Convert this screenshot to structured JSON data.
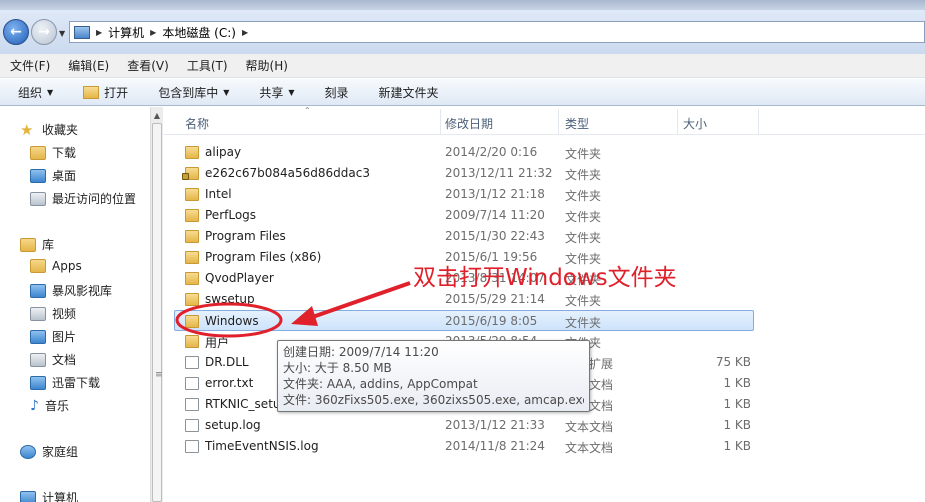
{
  "address": {
    "crumbs": [
      "计算机",
      "本地磁盘 (C:)"
    ]
  },
  "menu": [
    "文件(F)",
    "编辑(E)",
    "查看(V)",
    "工具(T)",
    "帮助(H)"
  ],
  "toolbar": {
    "organize": "组织",
    "open": "打开",
    "include": "包含到库中",
    "share": "共享",
    "burn": "刻录",
    "new_folder": "新建文件夹"
  },
  "nav": {
    "favorites": "收藏夹",
    "downloads": "下载",
    "desktop": "桌面",
    "recent": "最近访问的位置",
    "libraries": "库",
    "apps": "Apps",
    "storm": "暴风影视库",
    "videos": "视频",
    "pictures": "图片",
    "documents": "文档",
    "thunder": "迅雷下载",
    "music": "音乐",
    "homegroup": "家庭组",
    "computer": "计算机"
  },
  "columns": {
    "name": "名称",
    "modified": "修改日期",
    "type": "类型",
    "size": "大小"
  },
  "files": [
    {
      "name": "alipay",
      "date": "2014/2/20 0:16",
      "type": "文件夹",
      "size": ""
    },
    {
      "name": "e262c67b084a56d86ddac3",
      "date": "2013/12/11 21:32",
      "type": "文件夹",
      "size": ""
    },
    {
      "name": "Intel",
      "date": "2013/1/12 21:18",
      "type": "文件夹",
      "size": ""
    },
    {
      "name": "PerfLogs",
      "date": "2009/7/14 11:20",
      "type": "文件夹",
      "size": ""
    },
    {
      "name": "Program Files",
      "date": "2015/1/30 22:43",
      "type": "文件夹",
      "size": ""
    },
    {
      "name": "Program Files (x86)",
      "date": "2015/6/1 19:56",
      "type": "文件夹",
      "size": ""
    },
    {
      "name": "QvodPlayer",
      "date": "2013/8/31 14:07",
      "type": "文件夹",
      "size": ""
    },
    {
      "name": "swsetup",
      "date": "2015/5/29 21:14",
      "type": "文件夹",
      "size": ""
    },
    {
      "name": "Windows",
      "date": "2015/6/19 8:05",
      "type": "文件夹",
      "size": ""
    },
    {
      "name": "用户",
      "date": "2013/5/29 8:54",
      "type": "文件夹",
      "size": ""
    },
    {
      "name": "DR.DLL",
      "date": "",
      "type": "程序扩展",
      "size": "75 KB"
    },
    {
      "name": "error.txt",
      "date": "",
      "type": "文本文档",
      "size": "1 KB"
    },
    {
      "name": "RTKNIC_setup",
      "date": "",
      "type": "文本文档",
      "size": "1 KB"
    },
    {
      "name": "setup.log",
      "date": "2013/1/12 21:33",
      "type": "文本文档",
      "size": "1 KB"
    },
    {
      "name": "TimeEventNSIS.log",
      "date": "2014/11/8 21:24",
      "type": "文本文档",
      "size": "1 KB"
    }
  ],
  "tooltip": {
    "created": "创建日期: 2009/7/14 11:20",
    "size": "大小: 大于 8.50 MB",
    "folders": "文件夹: AAA, addins, AppCompat",
    "files": "文件: 360zFixs505.exe, 360zixs505.exe, amcap.exe, ..."
  },
  "annotation": {
    "text": "双击打开Windows文件夹",
    "color": "#e0202b"
  }
}
